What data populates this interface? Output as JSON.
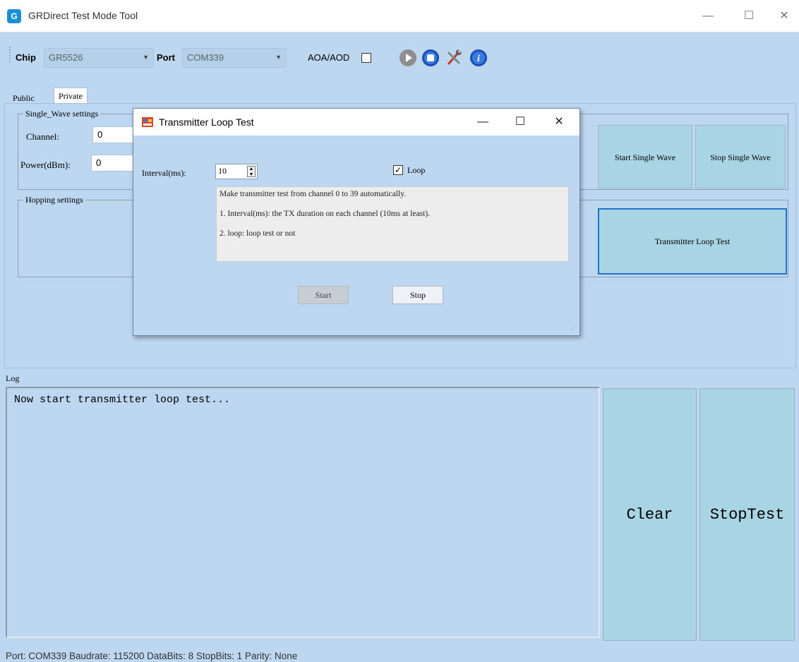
{
  "window": {
    "title": "GRDirect Test Mode Tool",
    "minimize_glyph": "—",
    "maximize_glyph": "☐",
    "close_glyph": "✕"
  },
  "toolbar": {
    "chip_label": "Chip",
    "chip_value": "GR5526",
    "port_label": "Port",
    "port_value": "COM339",
    "aoa_label": "AOA/AOD",
    "aoa_checked": false,
    "icons": [
      "play-icon",
      "stop-icon",
      "tools-icon",
      "info-icon"
    ]
  },
  "tabs": [
    {
      "label": "Public",
      "active": false
    },
    {
      "label": "Private",
      "active": true
    }
  ],
  "single_wave": {
    "title": "Single_Wave settings",
    "channel_label": "Channel:",
    "channel_value": "0",
    "power_label": "Power(dBm):",
    "power_value": "0",
    "start_label": "Start Single Wave",
    "stop_label": "Stop Single Wave"
  },
  "hopping": {
    "title": "Hopping settings",
    "transmitter_loop_label": "Transmitter Loop Test"
  },
  "dialog": {
    "title": "Transmitter Loop Test",
    "interval_label": "Interval(ms):",
    "interval_value": "10",
    "loop_label": "Loop",
    "loop_checked": true,
    "info_lines": [
      "Make transmitter test from channel 0 to 39 automatically.",
      "1. Interval(ms): the TX duration on each channel (10ms at least).",
      "2. loop: loop test or not"
    ],
    "start_label": "Start",
    "stop_label": "Stop"
  },
  "log": {
    "label": "Log",
    "text": "Now start transmitter loop test...",
    "clear_label": "Clear",
    "stoptest_label": "StopTest"
  },
  "status": {
    "text": "Port: COM339  Baudrate: 115200  DataBits: 8  StopBits: 1  Parity: None"
  },
  "colors": {
    "background": "#BDD7F1",
    "button_fill": "#A9D4E4",
    "accent_border": "#1E74C8"
  }
}
